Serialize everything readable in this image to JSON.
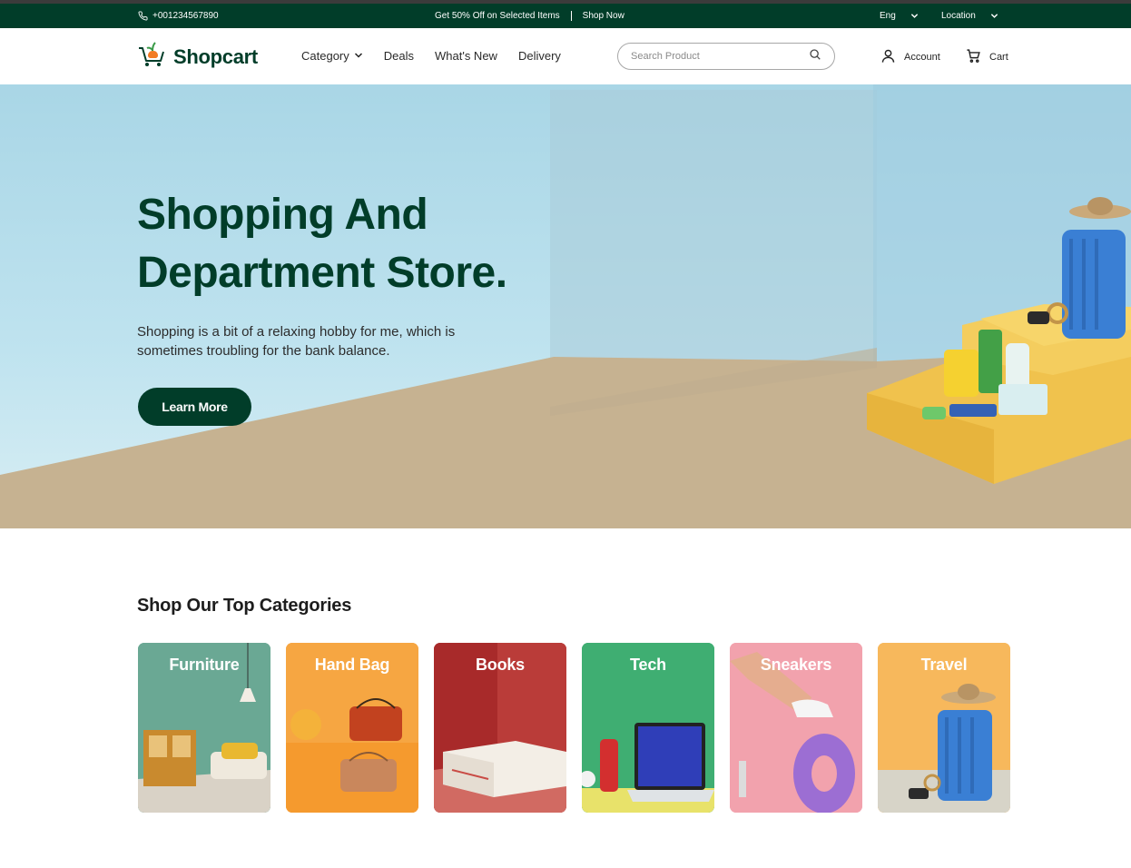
{
  "topbar": {
    "phone": "+001234567890",
    "promo": "Get 50% Off on Selected Items",
    "shop_now": "Shop Now",
    "language": "Eng",
    "location": "Location"
  },
  "brand": {
    "name": "Shopcart"
  },
  "nav": {
    "items": [
      {
        "label": "Category",
        "has_dropdown": true
      },
      {
        "label": "Deals"
      },
      {
        "label": "What's New"
      },
      {
        "label": "Delivery"
      }
    ]
  },
  "search": {
    "placeholder": "Search Product",
    "value": ""
  },
  "user": {
    "account": "Account",
    "cart": "Cart"
  },
  "hero": {
    "title_line1": "Shopping And",
    "title_line2": "Department Store.",
    "subtitle": "Shopping is a bit of a relaxing hobby for me, which is sometimes troubling for the bank balance.",
    "cta": "Learn More"
  },
  "categories": {
    "heading": "Shop Our Top Categories",
    "items": [
      {
        "label": "Furniture",
        "color": "#5f9f8c"
      },
      {
        "label": "Hand Bag",
        "color": "#f6a642"
      },
      {
        "label": "Books",
        "color": "#b02d2d"
      },
      {
        "label": "Tech",
        "color": "#3fae72"
      },
      {
        "label": "Sneakers",
        "color": "#f2a2ad"
      },
      {
        "label": "Travel",
        "color": "#f7b85c"
      }
    ]
  },
  "colors": {
    "brand": "#013d29",
    "topbar": "#013d29",
    "accent": "#f27b24"
  }
}
